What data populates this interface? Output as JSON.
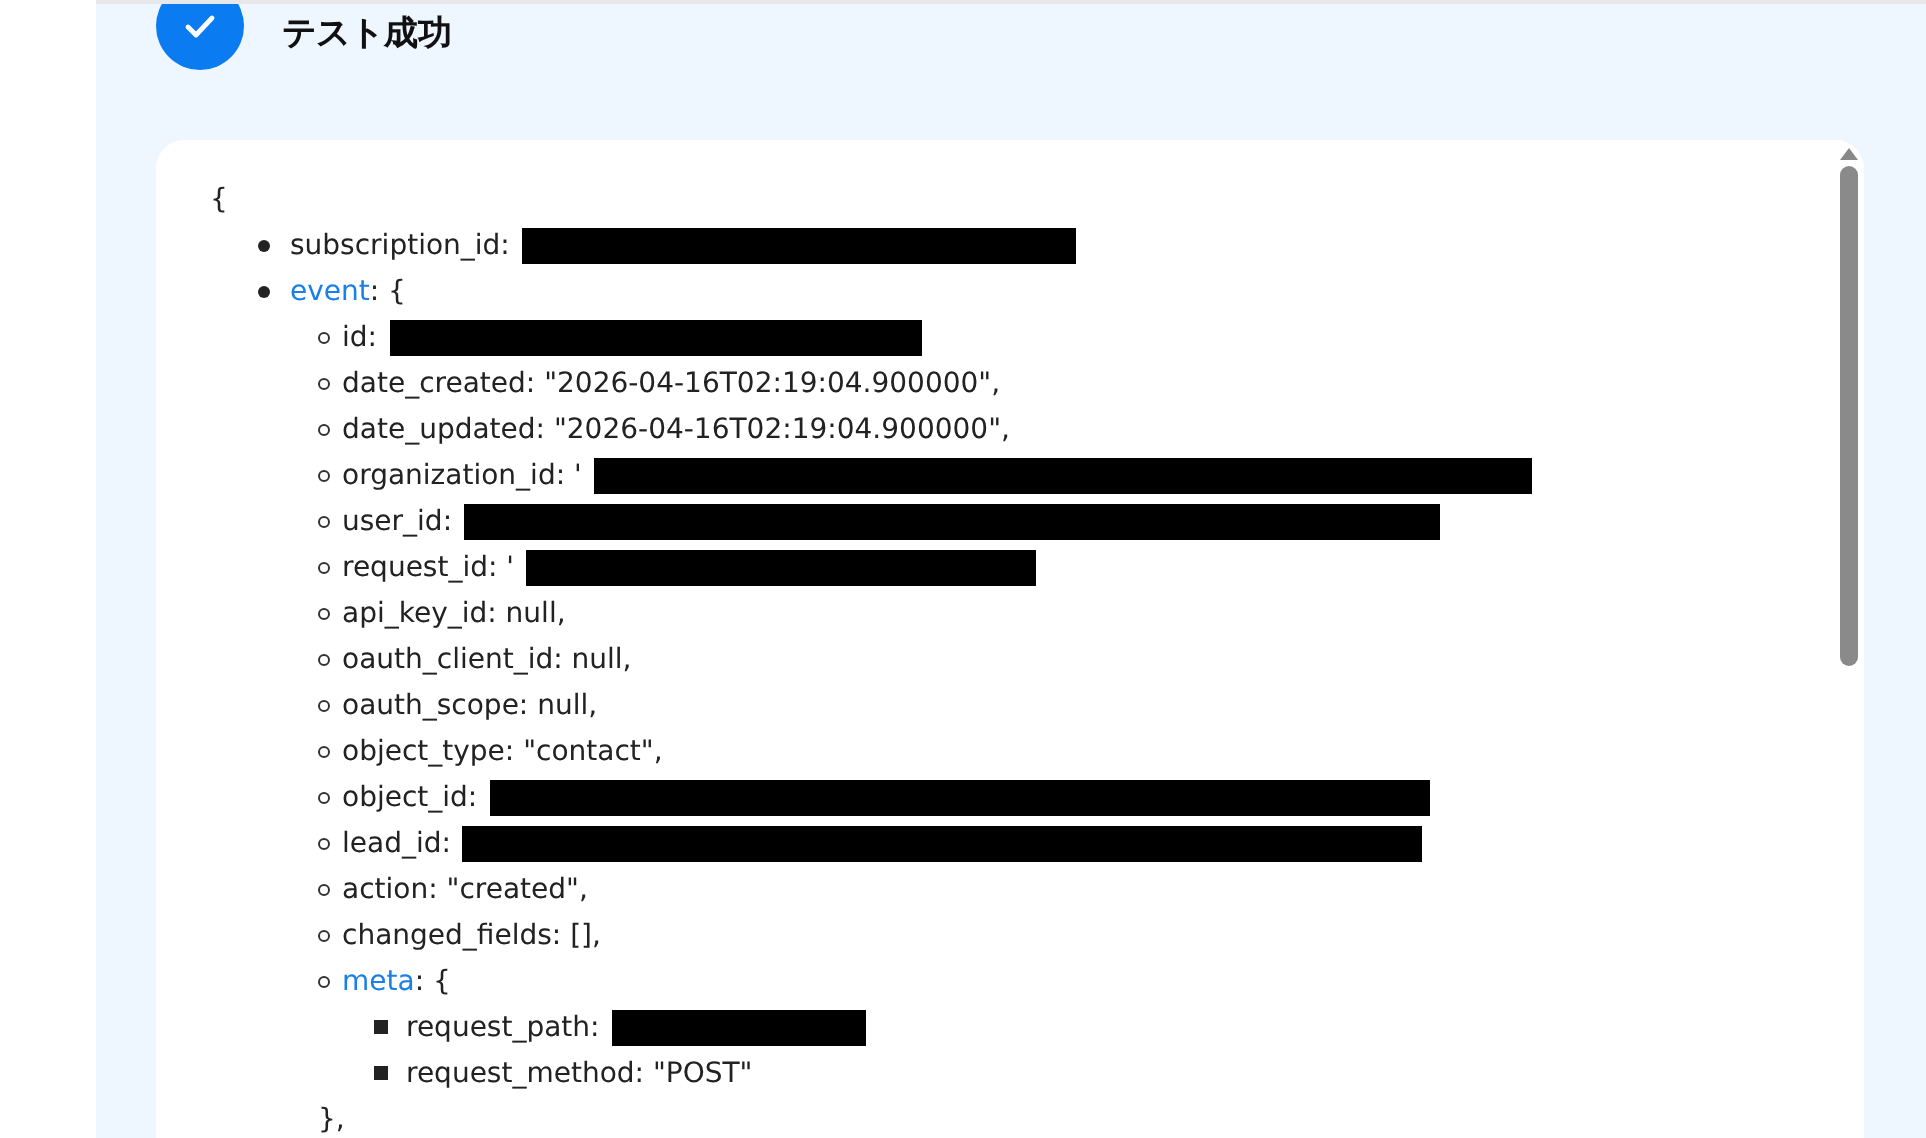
{
  "header": {
    "title": "テスト成功",
    "success": true
  },
  "payload": {
    "open": "{",
    "fields": [
      {
        "kind": "value",
        "label": "subscription_id:",
        "redacted": true
      },
      {
        "kind": "object",
        "key": "event",
        "label": ": {",
        "children": [
          {
            "kind": "value",
            "label": "id:",
            "redacted": true
          },
          {
            "kind": "value",
            "label": "date_created: \"2026-04-16T02:19:04.900000\","
          },
          {
            "kind": "value",
            "label": "date_updated: \"2026-04-16T02:19:04.900000\","
          },
          {
            "kind": "value",
            "label": "organization_id: '",
            "redacted": true
          },
          {
            "kind": "value",
            "label": "user_id:",
            "redacted": true
          },
          {
            "kind": "value",
            "label": "request_id: '",
            "redacted": true
          },
          {
            "kind": "value",
            "label": "api_key_id: null,"
          },
          {
            "kind": "value",
            "label": "oauth_client_id: null,"
          },
          {
            "kind": "value",
            "label": "oauth_scope: null,"
          },
          {
            "kind": "value",
            "label": "object_type: \"contact\","
          },
          {
            "kind": "value",
            "label": "object_id:",
            "redacted": true
          },
          {
            "kind": "value",
            "label": "lead_id:",
            "redacted": true
          },
          {
            "kind": "value",
            "label": "action: \"created\","
          },
          {
            "kind": "value",
            "label": "changed_fields: [],"
          },
          {
            "kind": "object",
            "key": "meta",
            "label": ": {",
            "close": "},",
            "children": [
              {
                "kind": "value",
                "label": "request_path:",
                "redacted": true
              },
              {
                "kind": "value",
                "label": "request_method: \"POST\""
              }
            ]
          }
        ]
      }
    ]
  }
}
